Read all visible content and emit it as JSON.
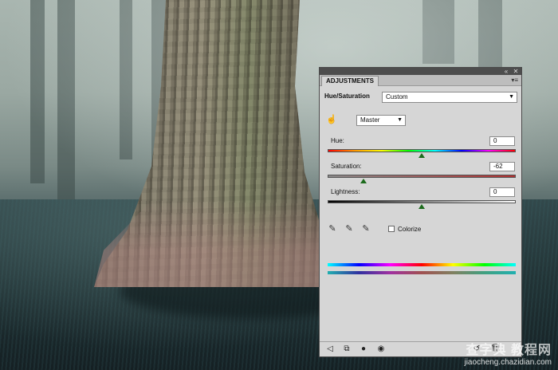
{
  "panel": {
    "tab_label": "ADJUSTMENTS",
    "adjustment_name": "Hue/Saturation",
    "preset_value": "Custom",
    "channel_value": "Master",
    "hue_label": "Hue:",
    "hue_value": "0",
    "saturation_label": "Saturation:",
    "saturation_value": "-62",
    "lightness_label": "Lightness:",
    "lightness_value": "0",
    "colorize_label": "Colorize",
    "colorize_checked": false
  },
  "sliders": {
    "hue_fraction": 0.5,
    "saturation_fraction": 0.19,
    "lightness_fraction": 0.5
  },
  "watermark": {
    "brand": "查字典 教程网",
    "url": "jiaocheng.chazidian.com"
  },
  "icons": {
    "titlebar": [
      "collapse-icon",
      "close-icon"
    ],
    "panel_menu": "panel-menu-icon",
    "target_adjust": "target-adjust-hand-icon",
    "eyedroppers": [
      "eyedropper-icon",
      "eyedropper-plus-icon",
      "eyedropper-minus-icon"
    ],
    "bottom": [
      "back-arrow-icon",
      "clip-to-layer-icon",
      "layer-mask-icon",
      "visibility-eye-icon",
      "reset-icon",
      "delete-icon"
    ]
  }
}
